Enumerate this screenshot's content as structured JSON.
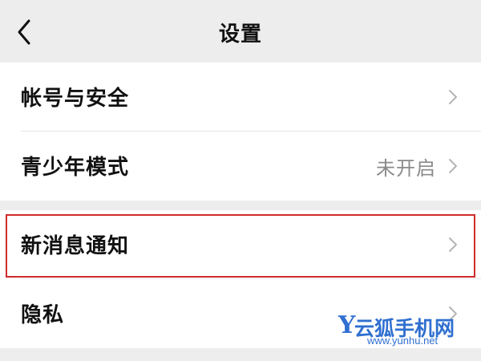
{
  "nav": {
    "title": "设置",
    "back_icon": "chevron-left-icon"
  },
  "groups": [
    {
      "items": [
        {
          "label": "帐号与安全",
          "value": "",
          "icon": "chevron-right-icon"
        },
        {
          "label": "青少年模式",
          "value": "未开启",
          "icon": "chevron-right-icon"
        }
      ]
    },
    {
      "items": [
        {
          "label": "新消息通知",
          "value": "",
          "icon": "chevron-right-icon",
          "highlighted": true
        },
        {
          "label": "隐私",
          "value": "",
          "icon": "chevron-right-icon"
        }
      ]
    }
  ],
  "watermark": {
    "y_letter": "Y",
    "text": "云狐手机网",
    "url": "www.yunhu.net"
  },
  "colors": {
    "background": "#ededed",
    "cell": "#ffffff",
    "highlight_border": "#d12b2b",
    "watermark": "#2f6fd0",
    "secondary_text": "#8a8a8a"
  }
}
